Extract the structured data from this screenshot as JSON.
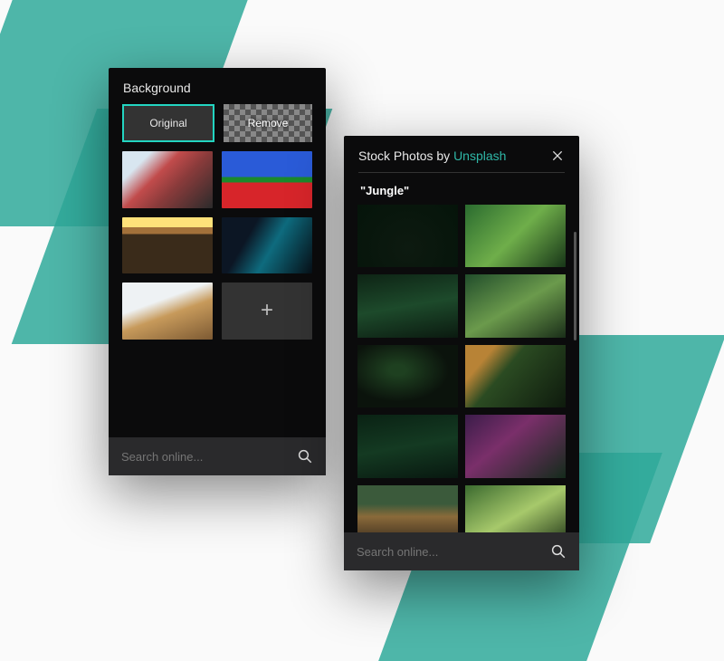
{
  "accent": "#23d5c1",
  "left_panel": {
    "title": "Background",
    "options": {
      "original": "Original",
      "remove": "Remove",
      "selected": "original"
    },
    "thumbs": [
      "p1",
      "p2",
      "p3",
      "p4",
      "p5"
    ],
    "add_label": "+",
    "search_placeholder": "Search online..."
  },
  "right_panel": {
    "title_prefix": "Stock Photos by ",
    "provider": "Unsplash",
    "query": "\"Jungle\"",
    "thumbs": [
      "j1",
      "j2",
      "j3",
      "j4",
      "j5",
      "j6",
      "j7",
      "j8",
      "j9",
      "j10",
      "j11"
    ],
    "search_placeholder": "Search online..."
  }
}
